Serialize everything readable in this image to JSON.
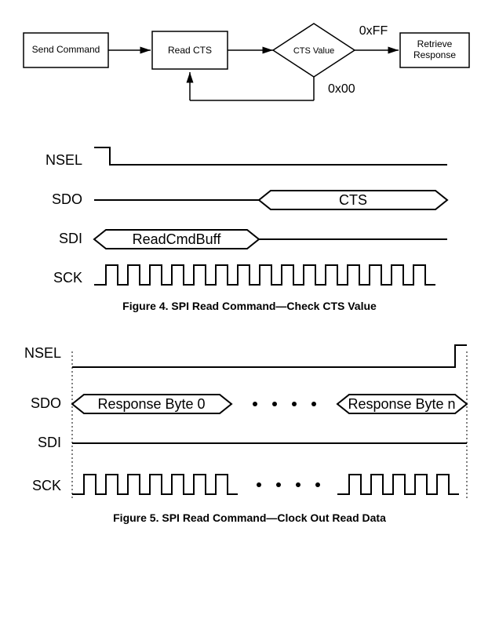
{
  "flow": {
    "send_command": "Send Command",
    "read_cts": "Read CTS",
    "cts_value": "CTS Value",
    "retrieve_response": "Retrieve\nResponse",
    "branch_true": "0xFF",
    "branch_false": "0x00"
  },
  "figure4": {
    "nsel": "NSEL",
    "sdo": "SDO",
    "sdi": "SDI",
    "sck": "SCK",
    "cts": "CTS",
    "readcmdbuff": "ReadCmdBuff",
    "caption": "Figure 4. SPI Read Command—Check CTS Value"
  },
  "figure5": {
    "nsel": "NSEL",
    "sdo": "SDO",
    "sdi": "SDI",
    "sck": "SCK",
    "resp0": "Response Byte 0",
    "respn": "Response Byte n",
    "caption": "Figure 5. SPI Read Command—Clock Out Read Data"
  }
}
